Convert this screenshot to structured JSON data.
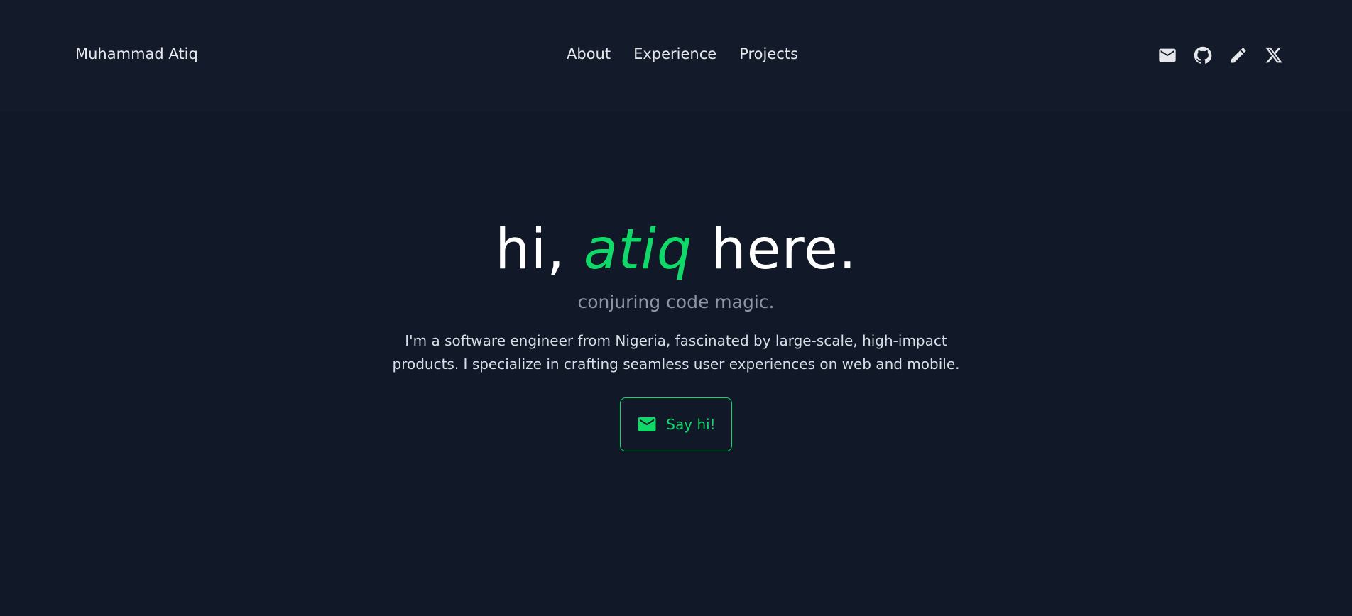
{
  "header": {
    "brand": "Muhammad Atiq",
    "nav": [
      {
        "label": "About"
      },
      {
        "label": "Experience"
      },
      {
        "label": "Projects"
      }
    ],
    "socials": [
      {
        "icon": "mail-icon"
      },
      {
        "icon": "github-icon"
      },
      {
        "icon": "pencil-icon"
      },
      {
        "icon": "x-twitter-icon"
      }
    ]
  },
  "hero": {
    "title_prefix": "hi, ",
    "title_name": "atiq",
    "title_suffix": " here.",
    "subtitle": "conjuring code magic.",
    "description": "I'm a software engineer from Nigeria, fascinated by large-scale, high-impact products. I specialize in crafting seamless user experiences on web and mobile.",
    "cta_label": "Say hi!",
    "cta_icon": "mail-icon"
  },
  "colors": {
    "background": "#111827",
    "header_background": "#131b2a",
    "accent": "#10d96a",
    "text": "#e5e7eb",
    "muted": "#8b95a5"
  }
}
